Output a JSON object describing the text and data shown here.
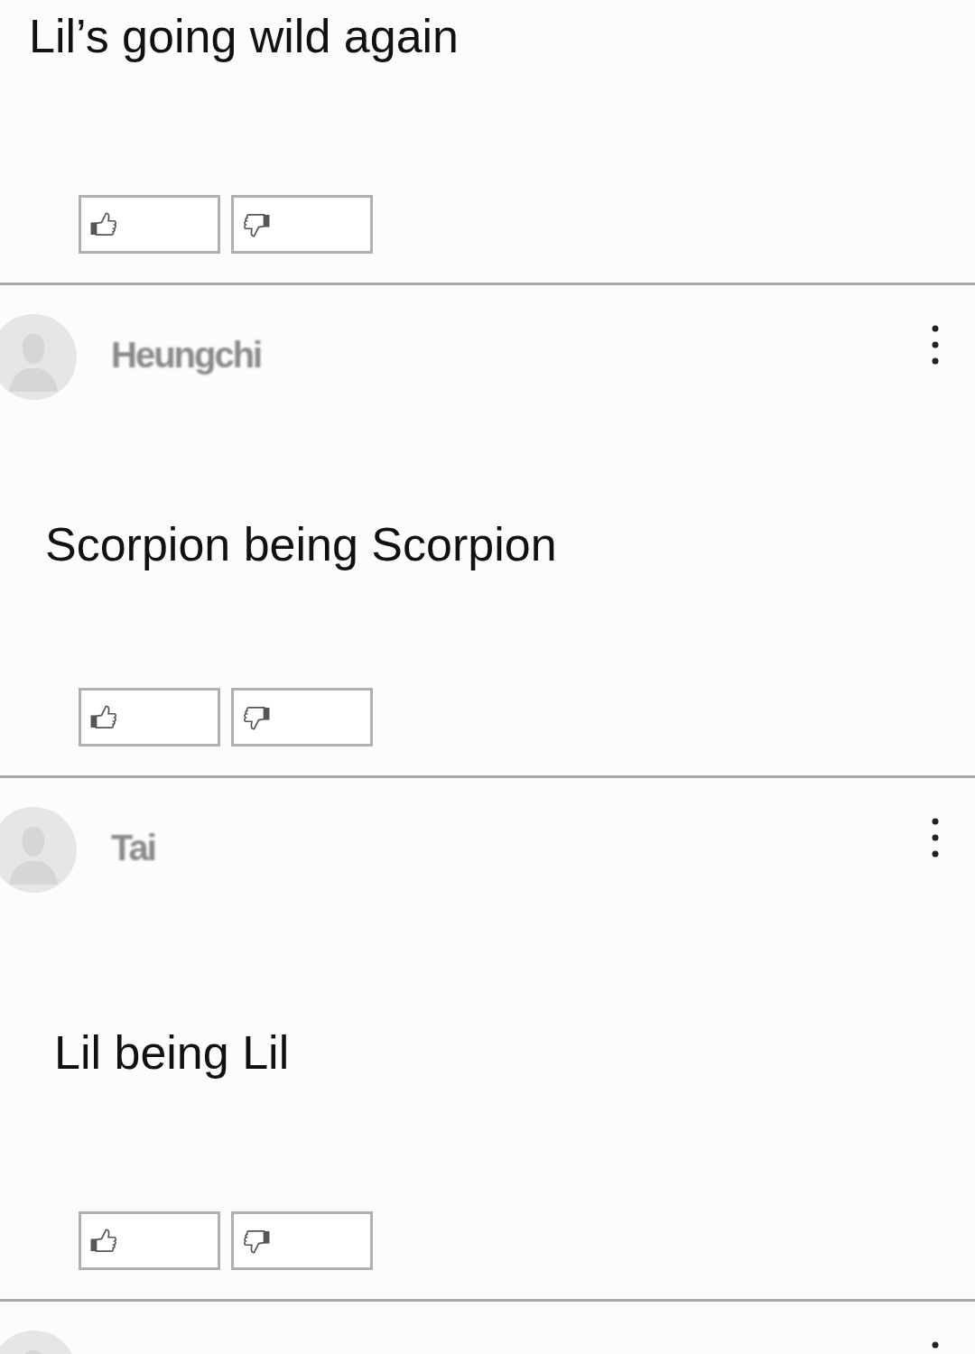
{
  "comments": [
    {
      "kind": "top-cut",
      "text": "Lil’s going wild again"
    },
    {
      "kind": "full",
      "author": "Heungchi",
      "text": "Scorpion being Scorpion"
    },
    {
      "kind": "full",
      "author": "Tai",
      "text": "Lil being Lil"
    },
    {
      "kind": "bottom-cut"
    }
  ]
}
